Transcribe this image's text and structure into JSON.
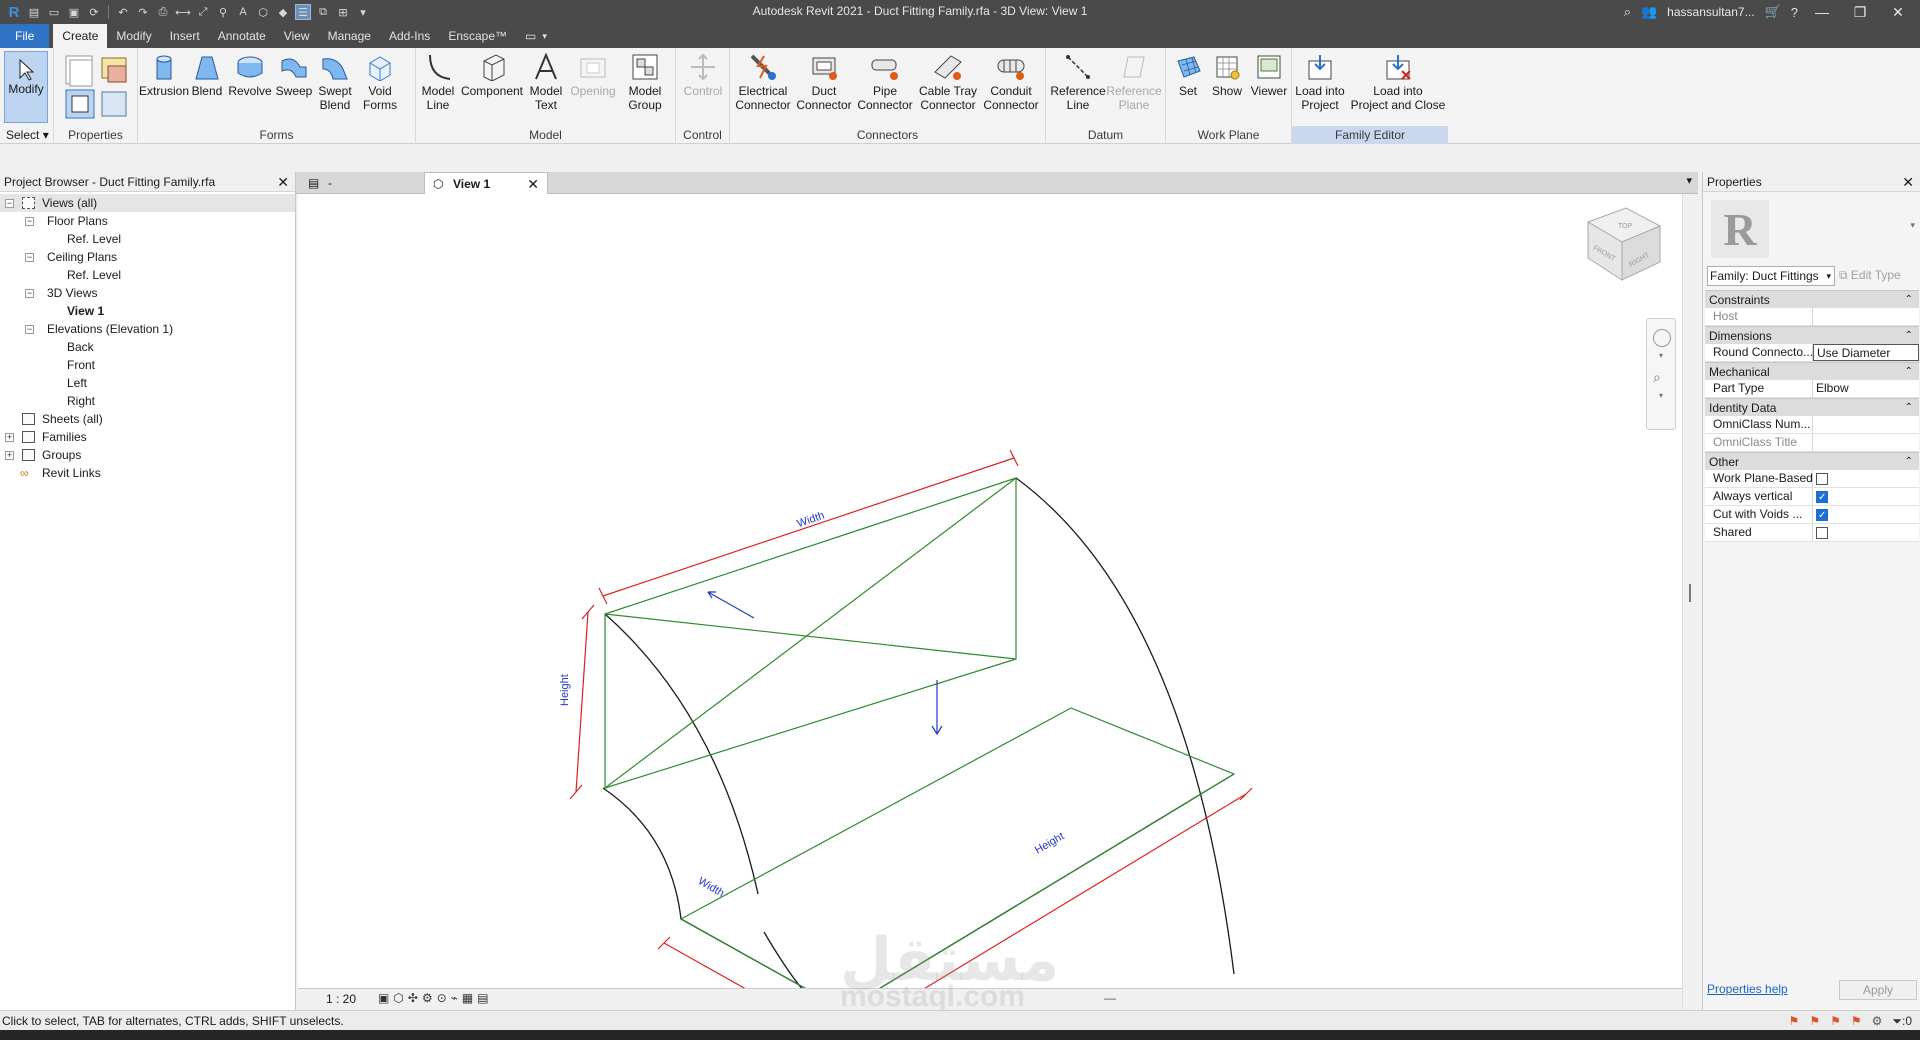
{
  "window": {
    "title": "Autodesk Revit 2021 - Duct Fitting Family.rfa - 3D View: View 1",
    "user": "hassansultan7..."
  },
  "ribbon_tabs": [
    "File",
    "Create",
    "Modify",
    "Insert",
    "Annotate",
    "View",
    "Manage",
    "Add-Ins",
    "Enscape™"
  ],
  "active_tab": "Create",
  "ribbon": {
    "select": {
      "modify": "Modify",
      "label": "Select"
    },
    "properties": {
      "label": "Properties"
    },
    "forms": {
      "label": "Forms",
      "extrusion": "Extrusion",
      "blend": "Blend",
      "revolve": "Revolve",
      "sweep": "Sweep",
      "swept_blend_1": "Swept",
      "swept_blend_2": "Blend",
      "void_1": "Void",
      "void_2": "Forms"
    },
    "model": {
      "label": "Model",
      "model_line_1": "Model",
      "model_line_2": "Line",
      "component": "Component",
      "model_text_1": "Model",
      "model_text_2": "Text",
      "opening": "Opening",
      "model_group_1": "Model",
      "model_group_2": "Group"
    },
    "control": {
      "label": "Control",
      "control": "Control"
    },
    "connectors": {
      "label": "Connectors",
      "electrical_1": "Electrical",
      "electrical_2": "Connector",
      "duct_1": "Duct",
      "duct_2": "Connector",
      "pipe_1": "Pipe",
      "pipe_2": "Connector",
      "cable_1": "Cable Tray",
      "cable_2": "Connector",
      "conduit_1": "Conduit",
      "conduit_2": "Connector"
    },
    "datum": {
      "label": "Datum",
      "refline_1": "Reference",
      "refline_2": "Line",
      "refplane_1": "Reference",
      "refplane_2": "Plane"
    },
    "workplane": {
      "label": "Work Plane",
      "set": "Set",
      "show": "Show",
      "viewer": "Viewer"
    },
    "family_editor": {
      "label": "Family Editor",
      "load_1": "Load into",
      "load_2": "Project",
      "loadclose_1": "Load into",
      "loadclose_2": "Project and Close"
    }
  },
  "project_browser": {
    "title": "Project Browser - Duct Fitting Family.rfa",
    "nodes": {
      "views_all": "Views (all)",
      "floor_plans": "Floor Plans",
      "fp_ref_level": "Ref. Level",
      "ceiling_plans": "Ceiling Plans",
      "cp_ref_level": "Ref. Level",
      "views_3d": "3D Views",
      "view1": "View 1",
      "elevations": "Elevations (Elevation 1)",
      "back": "Back",
      "front": "Front",
      "left": "Left",
      "right": "Right",
      "sheets": "Sheets (all)",
      "families": "Families",
      "groups": "Groups",
      "revit_links": "Revit Links"
    }
  },
  "view_tabs": {
    "tab1": "-",
    "tab2": "View 1"
  },
  "viewcube": {
    "top": "TOP",
    "front": "FRONT",
    "right": "RIGHT"
  },
  "canvas": {
    "dim_width_top": "Width",
    "dim_height_left": "Height",
    "dim_width_bottom": "Width",
    "dim_height_bottom": "Height"
  },
  "view_control": {
    "scale": "1 : 20"
  },
  "properties": {
    "title": "Properties",
    "family_select": "Family: Duct Fittings",
    "edit_type": "Edit Type",
    "categories": {
      "constraints": "Constraints",
      "dimensions": "Dimensions",
      "mechanical": "Mechanical",
      "identity": "Identity Data",
      "other": "Other"
    },
    "rows": {
      "host_k": "Host",
      "host_v": "",
      "round_k": "Round Connecto...",
      "round_v": "Use Diameter",
      "part_k": "Part Type",
      "part_v": "Elbow",
      "omni_num_k": "OmniClass Num...",
      "omni_num_v": "",
      "omni_title_k": "OmniClass Title",
      "omni_title_v": "",
      "wpb_k": "Work Plane-Based",
      "always_k": "Always vertical",
      "cut_k": "Cut with Voids ...",
      "shared_k": "Shared"
    },
    "checks": {
      "work_plane_based": false,
      "always_vertical": true,
      "cut_with_voids": true,
      "shared": false
    },
    "help": "Properties help",
    "apply": "Apply"
  },
  "status": {
    "text": "Click to select, TAB for alternates, CTRL adds, SHIFT unselects.",
    "filter_count": ":0"
  },
  "watermark": {
    "arabic": "مستقل",
    "latin": "mostaql.com"
  },
  "colors": {
    "accent": "#2f73c5",
    "green_edges": "#2e8b2e",
    "red_dims": "#e02020",
    "blue_text": "#1a2fd0"
  }
}
